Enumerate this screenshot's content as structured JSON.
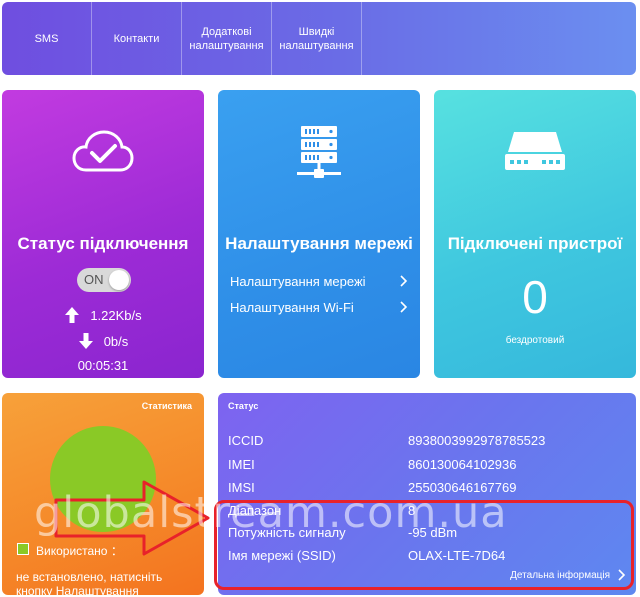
{
  "nav": {
    "items": [
      {
        "label": "SMS"
      },
      {
        "label": "Контакти"
      },
      {
        "label": "Додаткові налаштування"
      },
      {
        "label": "Швидкі налаштування"
      }
    ]
  },
  "connection": {
    "title": "Статус підключення",
    "toggle_label": "ON",
    "upload_rate": "1.22Kb/s",
    "download_rate": "0b/s",
    "duration": "00:05:31"
  },
  "network": {
    "title": "Налаштування мережі",
    "links": [
      {
        "label": "Налаштування мережі"
      },
      {
        "label": "Налаштування Wi-Fi"
      }
    ]
  },
  "devices": {
    "title": "Підключені пристрої",
    "count": "0",
    "type_label": "бездротовий"
  },
  "stats": {
    "title": "Статистика",
    "used_label": "Використано ：",
    "note": "не встановлено, натисніть кнопку Налаштування"
  },
  "info": {
    "title": "Статус",
    "rows": [
      {
        "key": "ICCID",
        "value": "89380039929787855​23"
      },
      {
        "key": "IMEI",
        "value": "860130064102936"
      },
      {
        "key": "IMSI",
        "value": "255030646167769"
      },
      {
        "key": "Діапазон",
        "value": "8"
      },
      {
        "key": "Потужність сигналу",
        "value": "-95 dBm"
      },
      {
        "key": "Імя мережі (SSID)",
        "value": "OLAX-LTE-7D64"
      }
    ],
    "detail_link": "Детальна інформація"
  },
  "overlay": {
    "watermark": "globalstream.com.ua",
    "highlight_color": "#e8222a"
  },
  "colors": {
    "status_card": "#9d2bd6",
    "network_card": "#2f8fe8",
    "devices_card": "#3fc7df",
    "stats_card": "#f58a2a",
    "info_card": "#6a75ee",
    "pie_used": "#8ac926"
  }
}
